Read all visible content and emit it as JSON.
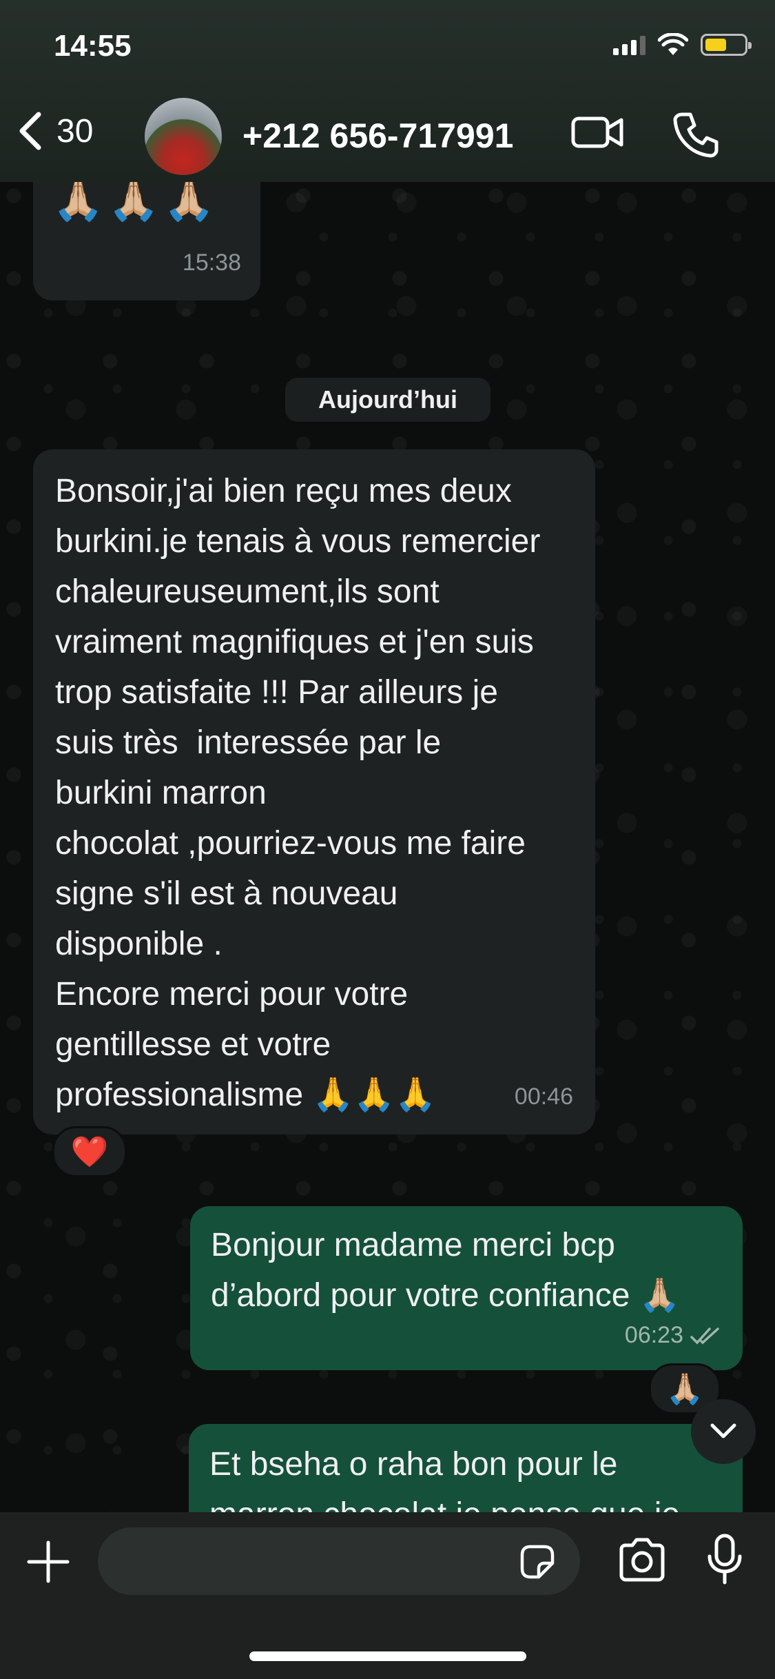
{
  "status_bar": {
    "time": "14:55"
  },
  "header": {
    "back_count": "30",
    "contact_name": "+212 656-717991",
    "icons": [
      "chevron-left-icon",
      "video-call-icon",
      "phone-call-icon"
    ]
  },
  "messages": {
    "prev": {
      "emoji": "🙏🏼🙏🏼🙏🏼",
      "time": "15:38"
    },
    "date_separator": "Aujourd’hui",
    "incoming_main": {
      "lines": [
        "Bonsoir,j'ai bien reçu mes deux",
        "burkini.je tenais à vous remercier",
        "chaleureuseument,ils sont",
        "vraiment magnifiques et j'en suis",
        "trop satisfaite !!! Par ailleurs je",
        "suis très  interessée par le",
        "burkini marron",
        "chocolat ,pourriez-vous me faire",
        "signe s'il est à nouveau",
        "disponible .",
        "Encore merci pour votre",
        "gentillesse et votre",
        "professionalisme 🙏🙏🙏"
      ],
      "time": "00:46",
      "reaction": "❤️"
    },
    "outgoing_1": {
      "lines": [
        "Bonjour madame merci bcp",
        "d’abord pour votre confiance 🙏🏼"
      ],
      "time": "06:23",
      "reaction": "🙏🏼"
    },
    "outgoing_2": {
      "lines": [
        "Et bseha o raha bon pour le",
        "marron chocolat je pense que je"
      ]
    }
  },
  "composer": {
    "icons": [
      "plus-icon",
      "sticker-icon",
      "camera-icon",
      "microphone-icon"
    ]
  },
  "colors": {
    "incoming_bubble": "#1f2223",
    "outgoing_bubble": "#15503a",
    "header_bg": "#1c2420",
    "battery": "#f5d11b"
  },
  "battery_level": 0.55
}
